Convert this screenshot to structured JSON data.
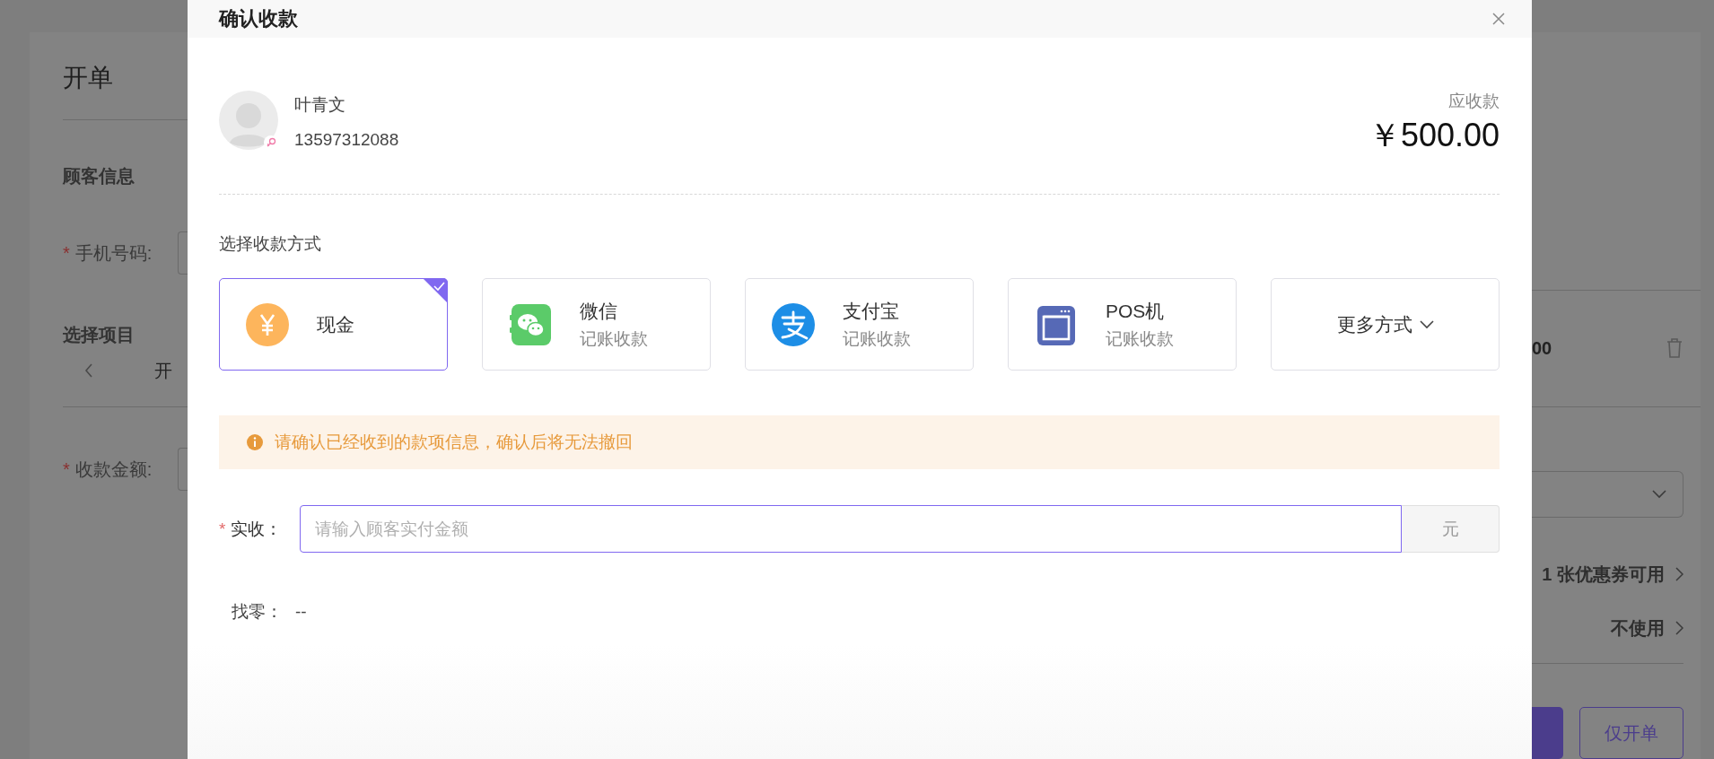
{
  "background": {
    "title": "开单",
    "customer_heading": "顾客信息",
    "phone": {
      "label": "手机号码:",
      "required_mark": "*"
    },
    "items_heading": "选择项目",
    "item_tab": "开",
    "amount": {
      "label": "收款金额:",
      "required_mark": "*"
    },
    "item_price": "00",
    "coupon_hint": "1 张优惠券可用",
    "coupon_choice": "不使用",
    "buttons": [
      {
        "kind": "primary"
      },
      {
        "kind": "outline",
        "label": "仅开单"
      }
    ]
  },
  "dialog": {
    "title": "确认收款",
    "customer": {
      "name": "叶青文",
      "phone": "13597312088"
    },
    "due_label": "应收款",
    "due_amount": "￥500.00",
    "method_heading": "选择收款方式",
    "methods": [
      {
        "kind": "cash",
        "label": "现金",
        "selected": true
      },
      {
        "kind": "wechat",
        "label": "微信",
        "sub": "记账收款",
        "selected": false
      },
      {
        "kind": "alipay",
        "label": "支付宝",
        "sub": "记账收款",
        "selected": false
      },
      {
        "kind": "pos",
        "label": "POS机",
        "sub": "记账收款",
        "selected": false
      },
      {
        "kind": "more",
        "label": "更多方式",
        "selected": false
      }
    ],
    "notice": "请确认已经收到的款项信息，确认后将无法撤回",
    "received": {
      "label": "实收：",
      "required_mark": "*",
      "placeholder": "请输入顾客实付金额",
      "unit": "元"
    },
    "change": {
      "label": "找零：",
      "value": "--"
    }
  }
}
